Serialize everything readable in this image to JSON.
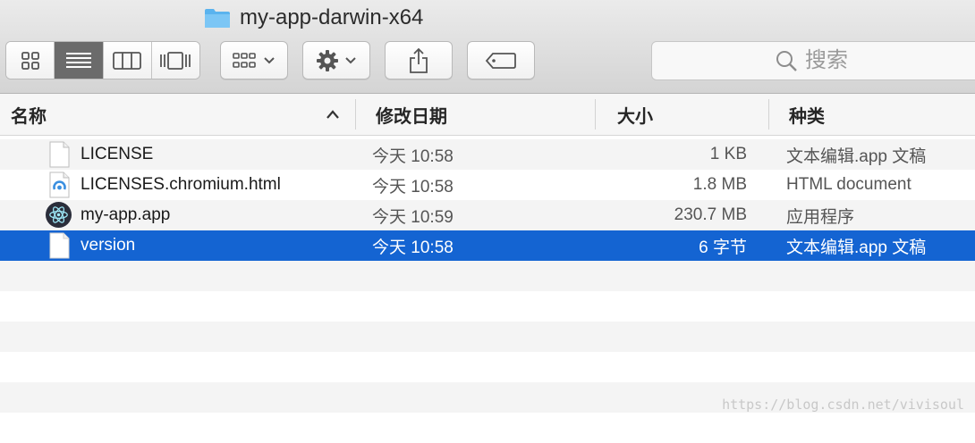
{
  "window": {
    "title": "my-app-darwin-x64"
  },
  "toolbar": {
    "view_modes": [
      {
        "name": "icon-view",
        "active": false
      },
      {
        "name": "list-view",
        "active": true
      },
      {
        "name": "column-view",
        "active": false
      },
      {
        "name": "cover-flow-view",
        "active": false
      }
    ],
    "search_placeholder": "搜索"
  },
  "columns": {
    "name": "名称",
    "date": "修改日期",
    "size": "大小",
    "kind": "种类"
  },
  "files": [
    {
      "name": "LICENSE",
      "date": "今天 10:58",
      "size": "1 KB",
      "kind": "文本编辑.app 文稿",
      "icon": "document-icon",
      "selected": false
    },
    {
      "name": "LICENSES.chromium.html",
      "date": "今天 10:58",
      "size": "1.8 MB",
      "kind": "HTML document",
      "icon": "html-document-icon",
      "selected": false
    },
    {
      "name": "my-app.app",
      "date": "今天 10:59",
      "size": "230.7 MB",
      "kind": "应用程序",
      "icon": "electron-app-icon",
      "selected": false
    },
    {
      "name": "version",
      "date": "今天 10:58",
      "size": "6 字节",
      "kind": "文本编辑.app 文稿",
      "icon": "document-icon",
      "selected": true
    }
  ],
  "colors": {
    "selection": "#1464d2",
    "folder": "#5ab3ee"
  },
  "watermark": "https://blog.csdn.net/vivisoul"
}
